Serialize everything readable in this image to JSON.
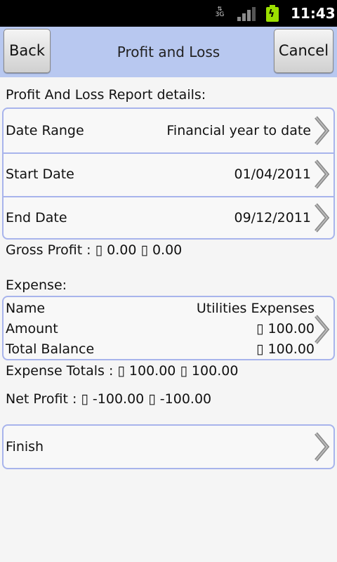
{
  "status_bar": {
    "network": "3G",
    "time": "11:43"
  },
  "title_bar": {
    "back_label": "Back",
    "title": "Profit and Loss",
    "cancel_label": "Cancel"
  },
  "report": {
    "heading": "Profit And Loss Report details:",
    "rows": [
      {
        "label": "Date Range",
        "value": "Financial year to date"
      },
      {
        "label": "Start Date",
        "value": "01/04/2011"
      },
      {
        "label": "End Date",
        "value": "09/12/2011"
      }
    ]
  },
  "gross_profit": "Gross Profit : ▯ 0.00    ▯ 0.00",
  "expense": {
    "heading": "Expense:",
    "name_label": "Name",
    "name_value": "Utilities Expenses",
    "amount_label": "Amount",
    "amount_value": "▯ 100.00",
    "total_label": "Total Balance",
    "total_value": "▯ 100.00"
  },
  "expense_totals": "Expense Totals : ▯ 100.00     ▯ 100.00",
  "net_profit": "Net Profit : ▯ -100.00    ▯ -100.00",
  "finish_label": "Finish"
}
